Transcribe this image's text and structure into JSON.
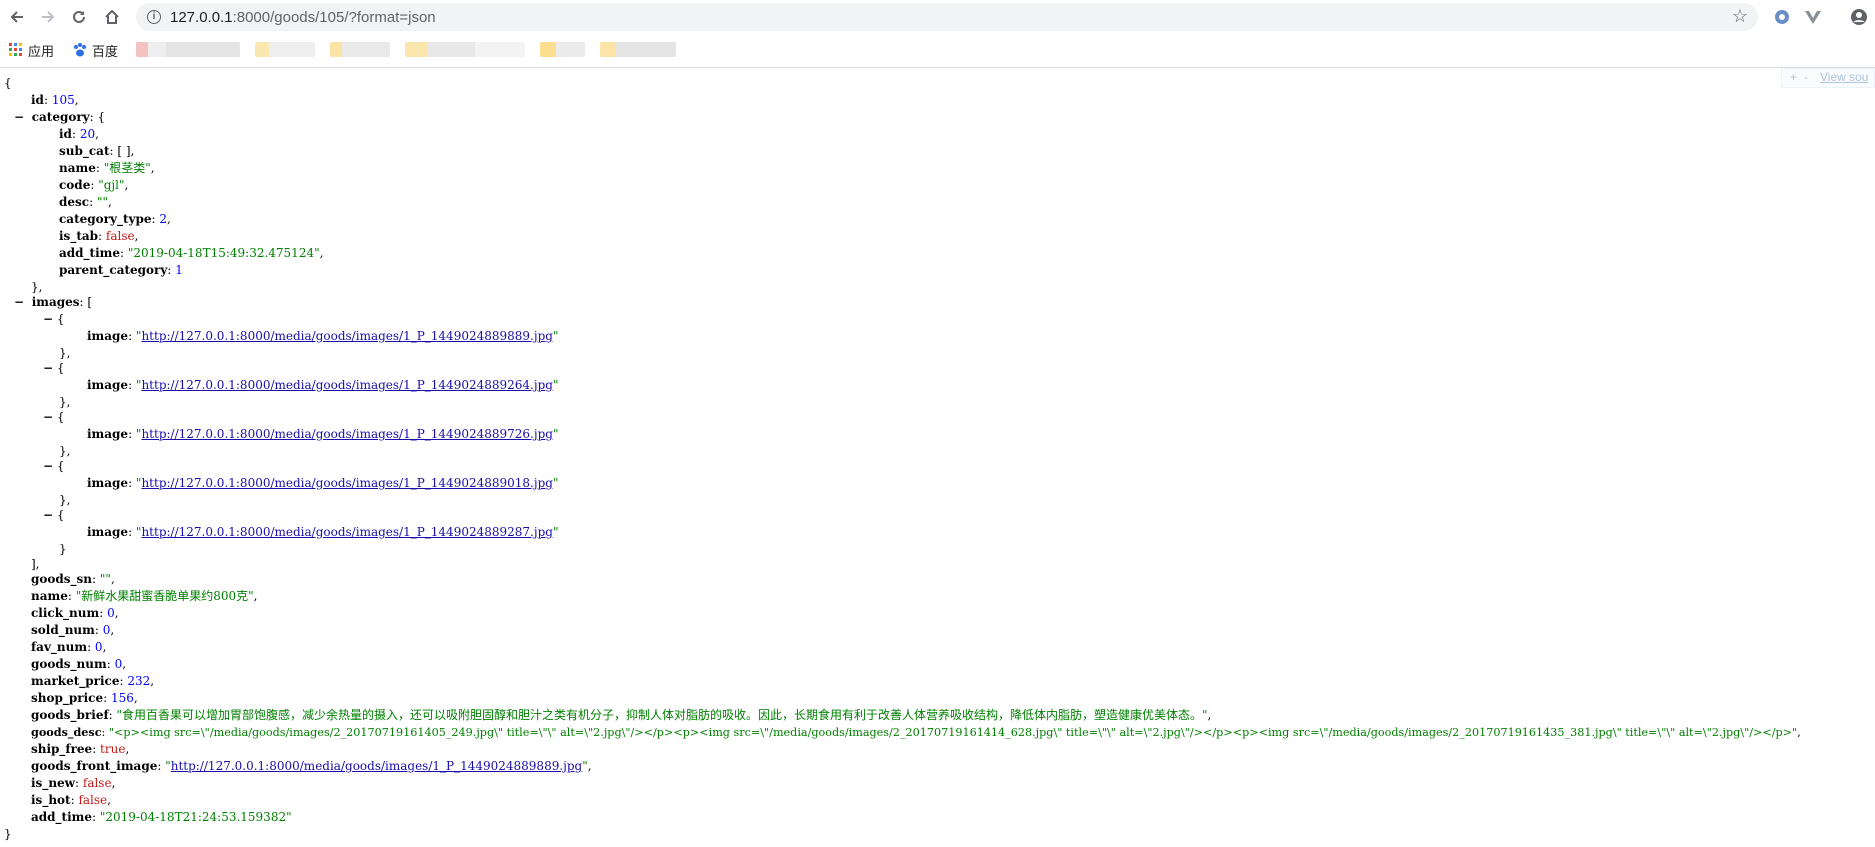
{
  "browser": {
    "url_host": "127.0.0.1",
    "url_rest": ":8000/goods/105/?format=json",
    "bookmarks": [
      {
        "label": "应用"
      },
      {
        "label": "百度"
      }
    ]
  },
  "viewer": {
    "plus": "+",
    "minus": "-",
    "view_source": "View sou"
  },
  "json": {
    "open": "{",
    "close": "}",
    "id": {
      "key": "id",
      "value": "105"
    },
    "category": {
      "key": "category",
      "id": {
        "key": "id",
        "value": "20"
      },
      "sub_cat": {
        "key": "sub_cat",
        "value": "[ ]"
      },
      "name": {
        "key": "name",
        "value": "\"根茎类\""
      },
      "code": {
        "key": "code",
        "value": "\"gjl\""
      },
      "desc": {
        "key": "desc",
        "value": "\"\""
      },
      "category_type": {
        "key": "category_type",
        "value": "2"
      },
      "is_tab": {
        "key": "is_tab",
        "value": "false"
      },
      "add_time": {
        "key": "add_time",
        "value": "\"2019-04-18T15:49:32.475124\""
      },
      "parent_category": {
        "key": "parent_category",
        "value": "1"
      }
    },
    "images": {
      "key": "images",
      "items": [
        {
          "key": "image",
          "value": "http://127.0.0.1:8000/media/goods/images/1_P_1449024889889.jpg"
        },
        {
          "key": "image",
          "value": "http://127.0.0.1:8000/media/goods/images/1_P_1449024889264.jpg"
        },
        {
          "key": "image",
          "value": "http://127.0.0.1:8000/media/goods/images/1_P_1449024889726.jpg"
        },
        {
          "key": "image",
          "value": "http://127.0.0.1:8000/media/goods/images/1_P_1449024889018.jpg"
        },
        {
          "key": "image",
          "value": "http://127.0.0.1:8000/media/goods/images/1_P_1449024889287.jpg"
        }
      ]
    },
    "goods_sn": {
      "key": "goods_sn",
      "value": "\"\""
    },
    "name": {
      "key": "name",
      "value": "\"新鲜水果甜蜜香脆单果约800克\""
    },
    "click_num": {
      "key": "click_num",
      "value": "0"
    },
    "sold_num": {
      "key": "sold_num",
      "value": "0"
    },
    "fav_num": {
      "key": "fav_num",
      "value": "0"
    },
    "goods_num": {
      "key": "goods_num",
      "value": "0"
    },
    "market_price": {
      "key": "market_price",
      "value": "232"
    },
    "shop_price": {
      "key": "shop_price",
      "value": "156"
    },
    "goods_brief": {
      "key": "goods_brief",
      "value": "\"食用百香果可以增加胃部饱腹感，减少余热量的摄入，还可以吸附胆固醇和胆汁之类有机分子，抑制人体对脂肪的吸收。因此，长期食用有利于改善人体营养吸收结构，降低体内脂肪，塑造健康优美体态。\""
    },
    "goods_desc": {
      "key": "goods_desc",
      "value": "\"<p><img src=\\\"/media/goods/images/2_20170719161405_249.jpg\\\" title=\\\"\\\" alt=\\\"2.jpg\\\"/></p><p><img src=\\\"/media/goods/images/2_20170719161414_628.jpg\\\" title=\\\"\\\" alt=\\\"2.jpg\\\"/></p><p><img src=\\\"/media/goods/images/2_20170719161435_381.jpg\\\" title=\\\"\\\" alt=\\\"2.jpg\\\"/></p>\""
    },
    "ship_free": {
      "key": "ship_free",
      "value": "true"
    },
    "goods_front_image": {
      "key": "goods_front_image",
      "value": "http://127.0.0.1:8000/media/goods/images/1_P_1449024889889.jpg"
    },
    "is_new": {
      "key": "is_new",
      "value": "false"
    },
    "is_hot": {
      "key": "is_hot",
      "value": "false"
    },
    "add_time": {
      "key": "add_time",
      "value": "\"2019-04-18T21:24:53.159382\""
    }
  }
}
